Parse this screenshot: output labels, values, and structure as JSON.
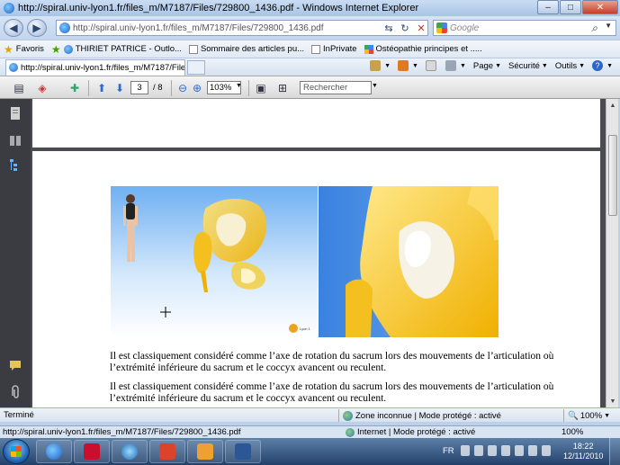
{
  "window": {
    "title": "http://spiral.univ-lyon1.fr/files_m/M7187/Files/729800_1436.pdf - Windows Internet Explorer",
    "minimize": "–",
    "maximize": "□",
    "close": "✕"
  },
  "address_bar": {
    "back": "◀",
    "forward": "▶",
    "url": "http://spiral.univ-lyon1.fr/files_m/M7187/Files/729800_1436.pdf",
    "refresh": "↻",
    "compat": "⇆",
    "stop": "✕",
    "search_placeholder": "Google",
    "search_icon": "⌕",
    "search_dropdown": "▼"
  },
  "favorites_bar": {
    "favorites_label": "Favoris",
    "items": [
      {
        "label": "THIRIET PATRICE - Outlo...",
        "icon": "ie-icon"
      },
      {
        "label": "Sommaire des articles pu...",
        "icon": "page-icon"
      },
      {
        "label": "InPrivate",
        "icon": "page-icon"
      },
      {
        "label": "Ostéopathie principes et .....",
        "icon": "google-icon"
      }
    ]
  },
  "tabs": [
    {
      "label": "http://spiral.univ-lyon1.fr/files_m/M7187/Files/7..."
    }
  ],
  "command_bar": {
    "page": "Page",
    "security": "Sécurité",
    "tools": "Outils",
    "help": "?",
    "dropdown": "▼"
  },
  "pdf_toolbar": {
    "current_page": "3",
    "total_pages": "/ 8",
    "zoom": "103%",
    "find_placeholder": "Rechercher",
    "dropdown": "▼"
  },
  "document": {
    "paragraphs": [
      "Il est classiquement considéré comme l’axe de rotation du sacrum lors des mouvements de l’articulation où l’extrémité inférieure du sacrum et le coccyx avancent ou reculent.",
      "Il est classiquement considéré comme l’axe de rotation du sacrum lors des mouvements de l’articulation où l’extrémité inférieure du sacrum et le coccyx avancent ou reculent."
    ],
    "logo_text": "Lyon 1"
  },
  "scrollbar": {
    "up": "▲",
    "down": "▼"
  },
  "status_bar": {
    "status": "Terminé",
    "zone": "Zone inconnue | Mode protégé : activé",
    "zoom": "100%",
    "dropdown": "▼"
  },
  "taskbar": {
    "hover_url": "http://spiral.univ-lyon1.fr/files_m/M7187/Files/729800_1436.pdf",
    "zone": "Internet | Mode protégé : activé",
    "zoom": "100%",
    "language": "FR",
    "time": "18:22",
    "date": "12/11/2010"
  },
  "colors": {
    "bone_yellow": "#f5c518",
    "sky_blue": "#4f8ee0",
    "page_bg": "#4a4c51"
  }
}
